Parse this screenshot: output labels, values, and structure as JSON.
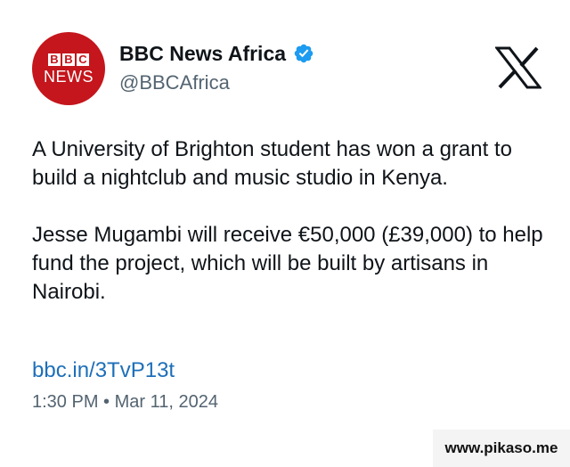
{
  "account": {
    "avatar_top": [
      "B",
      "B",
      "C"
    ],
    "avatar_bottom": "NEWS",
    "display_name": "BBC News Africa",
    "handle": "@BBCAfrica",
    "verified_icon": "verified-badge-icon"
  },
  "platform": {
    "logo_icon": "x-logo-icon"
  },
  "tweet": {
    "paragraphs": [
      "A University of Brighton student has won a grant to build a nightclub and music studio in Kenya.",
      "Jesse Mugambi will receive €50,000 (£39,000) to help fund the project, which will be built by artisans in Nairobi."
    ],
    "link": "bbc.in/3TvP13t",
    "time": "1:30 PM",
    "separator": "•",
    "date": "Mar 11, 2024"
  },
  "watermark": "www.pikaso.me",
  "colors": {
    "avatar_red": "#c4161c",
    "verified_blue": "#1d9bf0",
    "link_blue": "#1d6fb8",
    "muted_gray": "#536471",
    "text": "#0f1419"
  }
}
